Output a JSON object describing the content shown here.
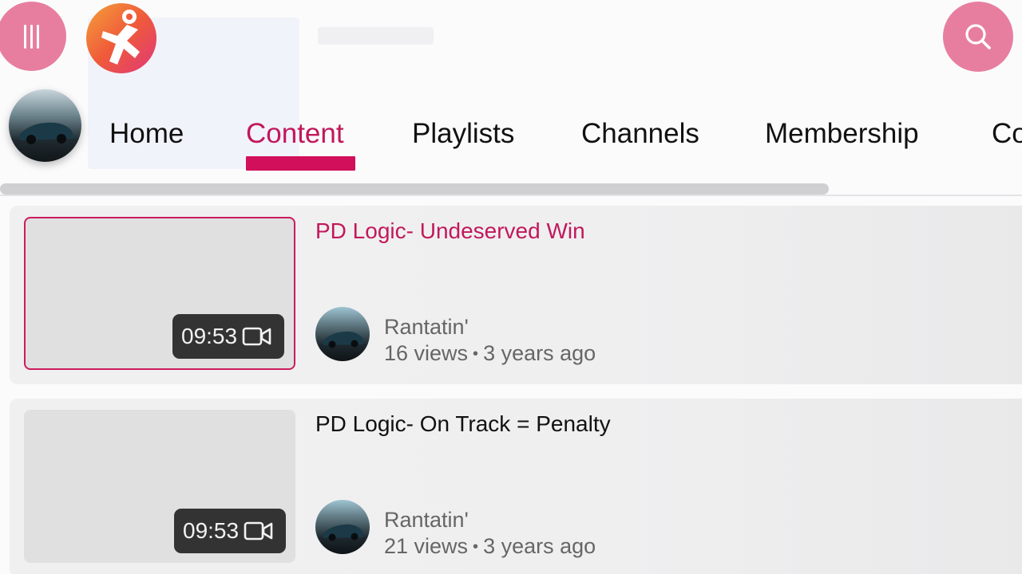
{
  "header": {
    "menu_icon": "menu-icon",
    "logo_icon": "app-logo-icon",
    "search_icon": "search-icon",
    "accent_color": "#e77ea0"
  },
  "channel": {
    "avatar_icon": "channel-avatar"
  },
  "tabs": [
    {
      "label": "Home",
      "active": false
    },
    {
      "label": "Content",
      "active": true
    },
    {
      "label": "Playlists",
      "active": false
    },
    {
      "label": "Channels",
      "active": false
    },
    {
      "label": "Membership",
      "active": false
    },
    {
      "label": "Co",
      "active": false
    }
  ],
  "active_color": "#c2185b",
  "videos": [
    {
      "title": "PD Logic- Undeserved Win",
      "duration": "09:53",
      "duration_icon": "video-camera-icon",
      "uploader": "Rantatin'",
      "views": "16 views",
      "age": "3 years ago",
      "focused": true
    },
    {
      "title": "PD Logic- On Track = Penalty",
      "duration": "09:53",
      "duration_icon": "video-camera-icon",
      "uploader": "Rantatin'",
      "views": "21 views",
      "age": "3 years ago",
      "focused": false
    }
  ]
}
